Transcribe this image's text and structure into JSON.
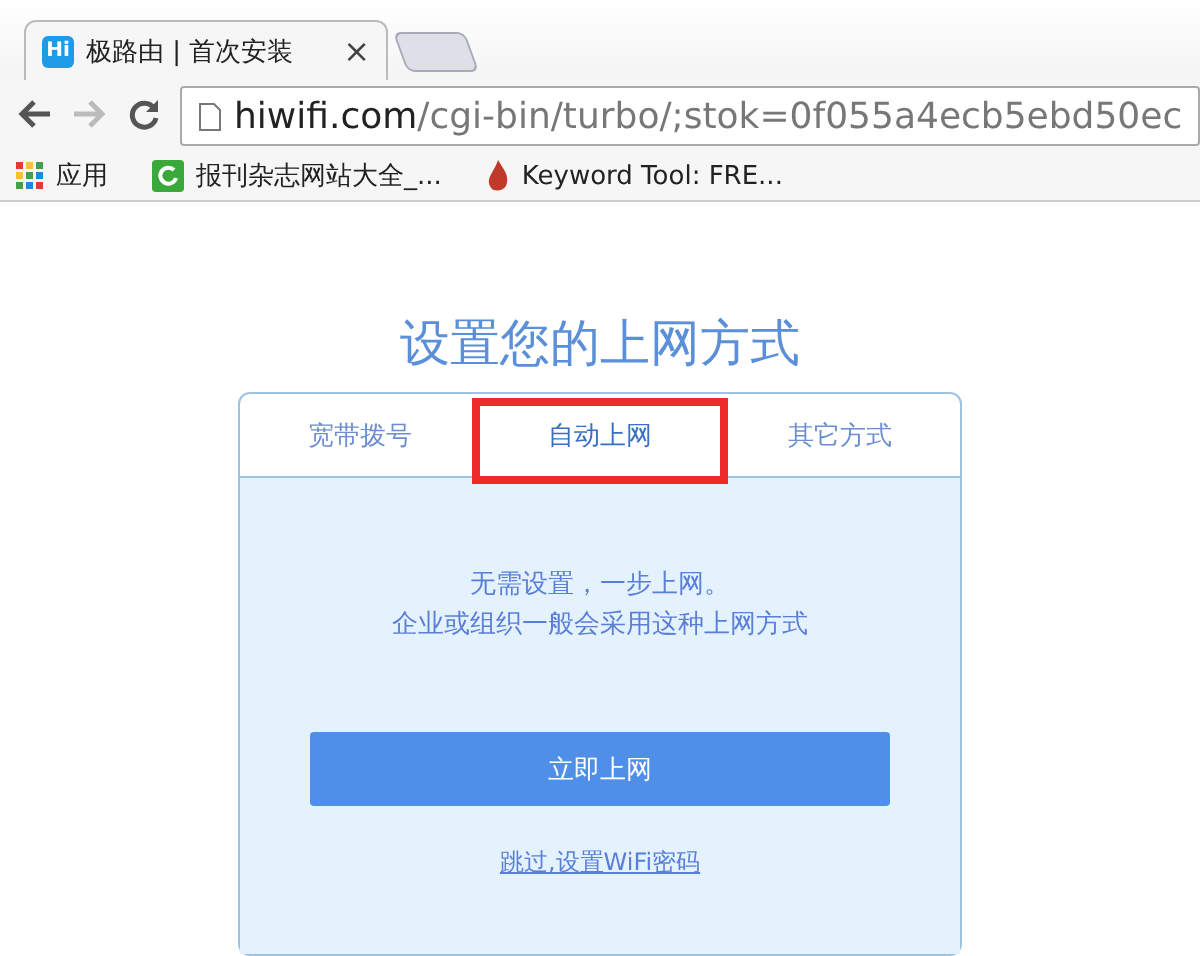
{
  "browser": {
    "tab": {
      "icon_text": "Hi",
      "title": "极路由 | 首次安装",
      "close": "×"
    },
    "address": {
      "host": "hiwifi.com",
      "path": "/cgi-bin/turbo/;stok=0f055a4ecb5ebd50ec"
    },
    "bookmarks": [
      {
        "kind": "apps",
        "label": "应用"
      },
      {
        "kind": "site",
        "label": "报刊杂志网站大全_..."
      },
      {
        "kind": "flame",
        "label": "Keyword Tool: FRE..."
      }
    ]
  },
  "page": {
    "heading": "设置您的上网方式",
    "tabs": [
      {
        "label": "宽带拨号",
        "selected": false,
        "highlighted": false
      },
      {
        "label": "自动上网",
        "selected": true,
        "highlighted": true
      },
      {
        "label": "其它方式",
        "selected": false,
        "highlighted": false
      }
    ],
    "description": [
      "无需设置，一步上网。",
      "企业或组织一般会采用这种上网方式"
    ],
    "primary_button": "立即上网",
    "skip_link": "跳过,设置WiFi密码"
  }
}
